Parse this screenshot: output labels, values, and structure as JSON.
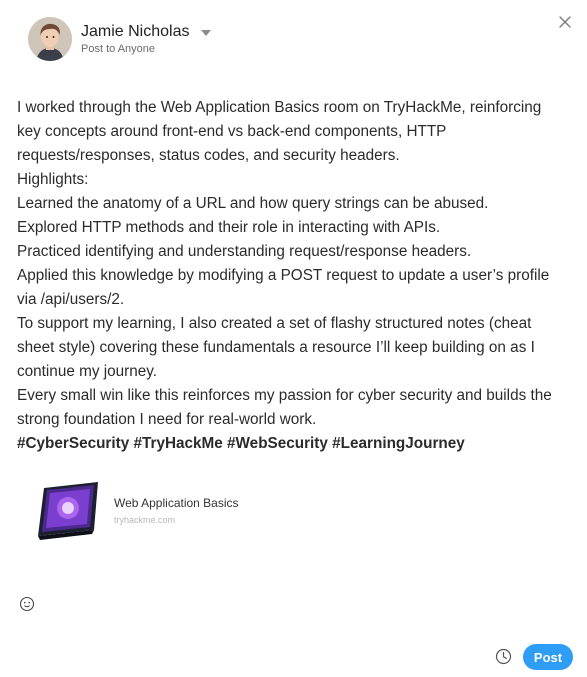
{
  "composer": {
    "author_name": "Jamie Nicholas",
    "visibility": "Post to Anyone",
    "body_lines": [
      "I worked through the Web Application Basics room on TryHackMe, reinforcing",
      "key concepts around front-end vs back-end components, HTTP",
      "requests/responses, status codes, and security headers.",
      "Highlights:",
      "Learned the anatomy of a URL and how query strings can be abused.",
      "Explored HTTP methods and their role in interacting with APIs.",
      "Practiced identifying and understanding request/response headers.",
      "Applied this knowledge by modifying a POST request to update a user’s profile",
      "via /api/users/2.",
      "To support my learning, I also created a set of flashy structured notes (cheat",
      "sheet style) covering these fundamentals a resource I’ll keep building on as I",
      "continue my journey.",
      "Every small win like this reinforces my passion for cyber security and builds the",
      "strong foundation I need for real-world work."
    ],
    "hashtags": "#CyberSecurity #TryHackMe #WebSecurity #LearningJourney"
  },
  "link_preview": {
    "title": "Web Application Basics",
    "domain": "tryhackme.com"
  },
  "actions": {
    "post_label": "Post"
  },
  "icons": {
    "close": "close-icon",
    "emoji": "emoji-icon",
    "schedule": "clock-icon",
    "dropdown": "caret-down-icon"
  },
  "colors": {
    "post_button": "#2d9df5",
    "text": "#2b2b2b"
  }
}
